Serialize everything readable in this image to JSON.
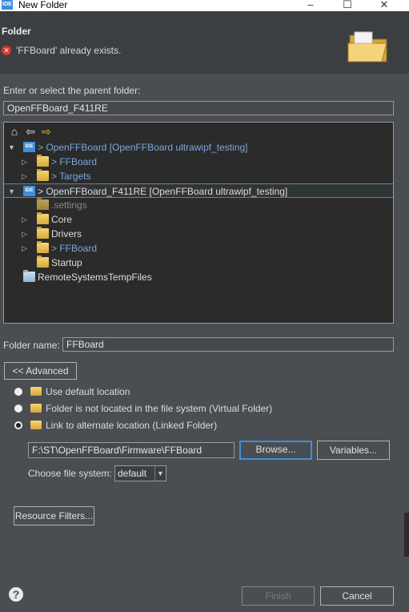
{
  "window": {
    "app_icon_text": "IDE",
    "title": "New Folder",
    "minimize_glyph": "–",
    "maximize_glyph": "☐",
    "close_glyph": "✕"
  },
  "header": {
    "title": "Folder",
    "error_glyph": "✕",
    "error_message": "'FFBoard' already exists."
  },
  "parent": {
    "label": "Enter or select the parent folder:",
    "value": "OpenFFBoard_F411RE"
  },
  "tree_toolbar": {
    "home_glyph": "⌂",
    "back_glyph": "⇦",
    "forward_glyph": "⇨"
  },
  "tree": [
    {
      "twisty": "▼",
      "icon": "IDE",
      "text": "> OpenFFBoard [OpenFFBoard ultrawipf_testing]",
      "color": "blue"
    },
    {
      "twisty": "▷",
      "text": "> FFBoard",
      "color": "blue"
    },
    {
      "twisty": "▷",
      "text": "> Targets",
      "color": "blue"
    },
    {
      "twisty": "▼",
      "icon": "IDE",
      "text": "> OpenFFBoard_F411RE [OpenFFBoard ultrawipf_testing]",
      "color": "light",
      "selected": true
    },
    {
      "twisty": "",
      "text": ".settings",
      "color": "gray"
    },
    {
      "twisty": "▷",
      "text": "Core",
      "color": "light"
    },
    {
      "twisty": "▷",
      "text": "Drivers",
      "color": "light"
    },
    {
      "twisty": "▷",
      "text": "> FFBoard",
      "color": "blue"
    },
    {
      "twisty": "",
      "text": "Startup",
      "color": "light"
    },
    {
      "twisty": "",
      "text": "RemoteSystemsTempFiles",
      "color": "light"
    }
  ],
  "folder_name": {
    "label": "Folder name:",
    "value": "FFBoard"
  },
  "advanced_button": "<< Advanced",
  "options": [
    {
      "label": "Use default location",
      "selected": false
    },
    {
      "label": "Folder is not located in the file system (Virtual Folder)",
      "selected": false
    },
    {
      "label": "Link to alternate location (Linked Folder)",
      "selected": true
    }
  ],
  "link": {
    "path": "F:\\ST\\OpenFFBoard\\Firmware\\FFBoard",
    "browse_label": "Browse...",
    "variables_label": "Variables..."
  },
  "file_system": {
    "label": "Choose file system:",
    "value": "default",
    "chevron_glyph": "▼"
  },
  "resource_filters_label": "Resource Filters...",
  "footer": {
    "help_glyph": "?",
    "finish_label": "Finish",
    "cancel_label": "Cancel"
  }
}
